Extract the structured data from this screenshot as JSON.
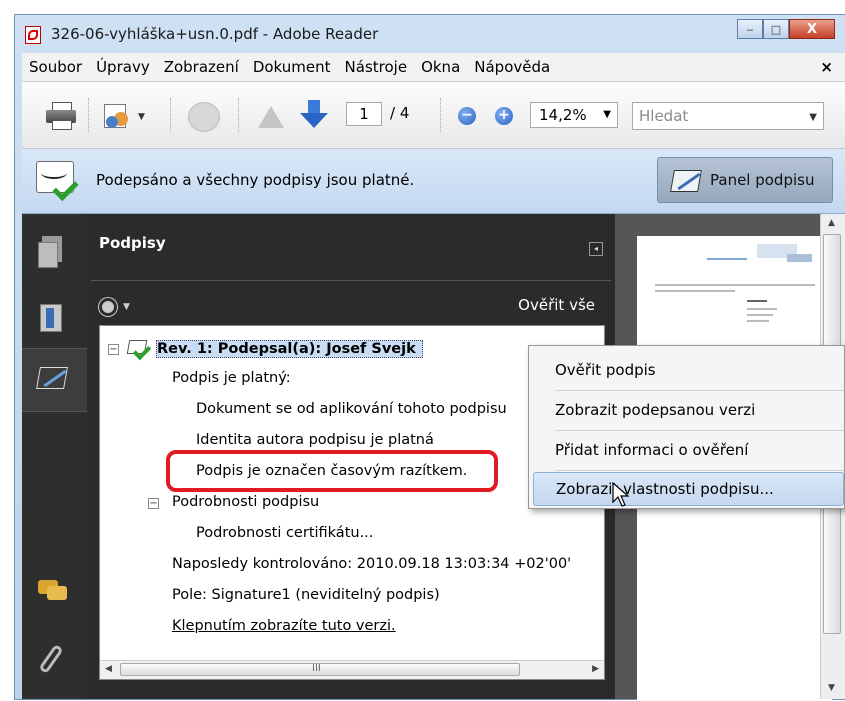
{
  "window": {
    "title": "326-06-vyhláška+usn.0.pdf - Adobe Reader",
    "controls": {
      "minimize": "‒",
      "maximize": "□",
      "close": "X"
    }
  },
  "menubar": {
    "items": [
      "Soubor",
      "Úpravy",
      "Zobrazení",
      "Dokument",
      "Nástroje",
      "Okna",
      "Nápověda"
    ],
    "close_symbol": "×"
  },
  "toolbar": {
    "page_current": "1",
    "page_total": "/ 4",
    "zoom": "14,2%",
    "search_placeholder": "Hledat",
    "zoom_out_symbol": "−",
    "zoom_in_symbol": "+",
    "dropdown_symbol": "▼"
  },
  "signature_bar": {
    "message": "Podepsáno a všechny podpisy jsou platné.",
    "panel_button": "Panel podpisu"
  },
  "signatures_panel": {
    "title": "Podpisy",
    "verify_all": "Ověřit vše",
    "collapse_symbol": "◂",
    "tree": {
      "revision": "Rev. 1: Podepsal(a): Josef Svejk",
      "valid": "Podpis je platný:",
      "doc_unchanged": "Dokument se od aplikování tohoto podpisu",
      "identity_valid": "Identita autora podpisu je platná",
      "timestamp": "Podpis je označen časovým razítkem.",
      "details": "Podrobnosti podpisu",
      "cert_details": "Podrobnosti certifikátu...",
      "last_checked": "Naposledy kontrolováno: 2010.09.18 13:03:34 +02'00'",
      "field": "Pole: Signature1 (neviditelný podpis)",
      "view_version": "Klepnutím zobrazíte tuto verzi.",
      "expander_symbol": "−"
    },
    "scrollbar": {
      "left": "◀",
      "right": "▶",
      "grip": "III"
    }
  },
  "context_menu": {
    "items": [
      {
        "label": "Ověřit podpis"
      },
      {
        "label": "Zobrazit podepsanou verzi"
      },
      {
        "label": "Přidat informaci o ověření"
      },
      {
        "label": "Zobrazit vlastnosti podpisu..."
      }
    ]
  },
  "doc_scrollbar": {
    "up": "▲",
    "down": "▼"
  },
  "colors": {
    "highlight_ring": "#e01b24",
    "valid_check": "#2aa02a",
    "selection": "#c8dcf3"
  }
}
